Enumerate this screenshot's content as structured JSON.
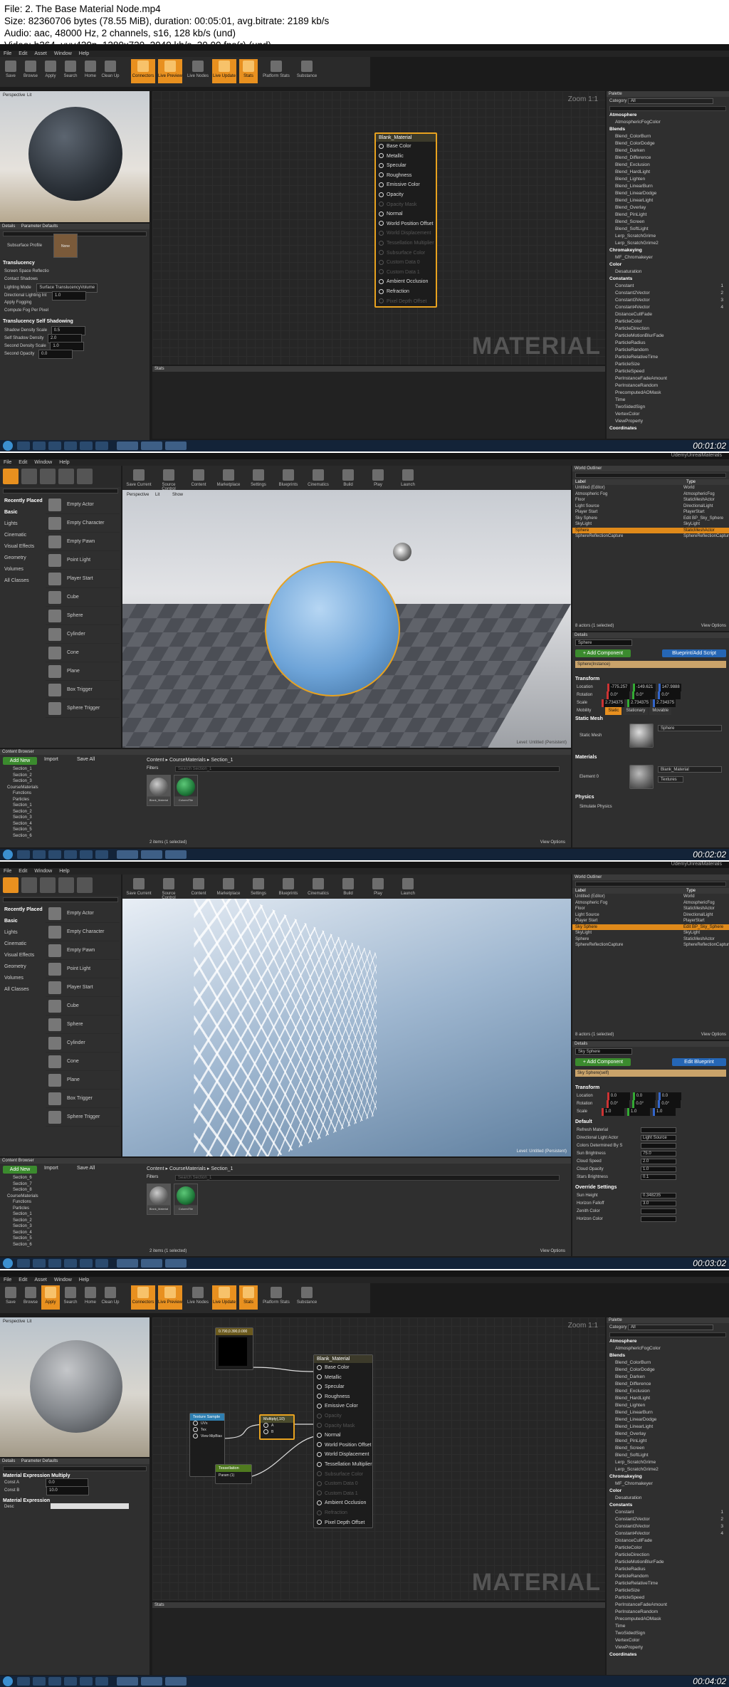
{
  "header": {
    "line1": "File: 2. The Base Material Node.mp4",
    "line2": "Size: 82360706 bytes (78.55 MiB), duration: 00:05:01, avg.bitrate: 2189 kb/s",
    "line3": "Audio: aac, 48000 Hz, 2 channels, s16, 128 kb/s (und)",
    "line4": "Video: h264, yuv420p, 1280x720, 2049 kb/s, 30.00 fps(r) (und)"
  },
  "menus": {
    "material_editor": [
      "File",
      "Edit",
      "Asset",
      "Window",
      "Help"
    ],
    "level_editor": [
      "File",
      "Edit",
      "Window",
      "Help"
    ]
  },
  "material_toolbar": [
    "Save",
    "Browse",
    "Apply",
    "Search",
    "Home",
    "Clean Up",
    "Connectors",
    "Live Preview",
    "Live Nodes",
    "Live Update",
    "Stats",
    "Platform Stats",
    "Substance"
  ],
  "level_toolbar": [
    "Save Current",
    "Source Control",
    "Content",
    "Marketplace",
    "Settings",
    "Blueprints",
    "Cinematics",
    "Build",
    "Play",
    "Launch"
  ],
  "project_name": "UdemyUnrealMaterials",
  "viewport": {
    "perspective": "Perspective",
    "lit": "Lit",
    "show": "Show",
    "level_label": "Level:  Untitled (Persistent)"
  },
  "graph": {
    "zoom": "Zoom 1:1",
    "watermark": "MATERIAL",
    "stats_tab": "Stats"
  },
  "base_node": {
    "title": "Blank_Material",
    "pins": [
      "Base Color",
      "Metallic",
      "Specular",
      "Roughness",
      "Emissive Color",
      "Opacity",
      "Opacity Mask",
      "Normal",
      "World Position Offset",
      "World Displacement",
      "Tessellation Multiplier",
      "Subsurface Color",
      "Custom Data 0",
      "Custom Data 1",
      "Ambient Occlusion",
      "Refraction",
      "Pixel Depth Offset"
    ],
    "dim_pins_frame1": [
      6,
      9,
      10,
      11,
      12,
      13,
      16
    ],
    "dim_pins_frame4": [
      5,
      6,
      11,
      12,
      13,
      15
    ]
  },
  "details_frame1": {
    "tabs": [
      "Details",
      "Parameter Defaults"
    ],
    "subsurface_label": "Subsurface Profile",
    "subsurface_value": "None",
    "section_translucency": "Translucency",
    "translucency_rows": [
      "Screen Space Reflectio",
      "Contact Shadows",
      "Lighting Mode",
      "Directional Lighting Int",
      "Apply Fogging",
      "Compute Fog Per Pixel"
    ],
    "lighting_mode_value": "Surface TranslucencyVolume",
    "directional_value": "1.0",
    "section_self_shadow": "Translucency Self Shadowing",
    "self_shadow_rows": [
      [
        "Shadow Density Scale",
        "0.5"
      ],
      [
        "Self Shadow Density",
        "2.0"
      ],
      [
        "Second Density Scale",
        "1.0"
      ],
      [
        "Second Opacity",
        "0.0"
      ]
    ]
  },
  "palette": {
    "title": "Palette",
    "category_label": "Category",
    "category_value": "All",
    "items": [
      {
        "t": "Atmosphere",
        "c": true
      },
      {
        "t": "AtmosphericFogColor"
      },
      {
        "t": "Blends",
        "c": true
      },
      {
        "t": "Blend_ColorBurn"
      },
      {
        "t": "Blend_ColorDodge"
      },
      {
        "t": "Blend_Darken"
      },
      {
        "t": "Blend_Difference"
      },
      {
        "t": "Blend_Exclusion"
      },
      {
        "t": "Blend_HardLight"
      },
      {
        "t": "Blend_Lighten"
      },
      {
        "t": "Blend_LinearBurn"
      },
      {
        "t": "Blend_LinearDodge"
      },
      {
        "t": "Blend_LinearLight"
      },
      {
        "t": "Blend_Overlay"
      },
      {
        "t": "Blend_PinLight"
      },
      {
        "t": "Blend_Screen"
      },
      {
        "t": "Blend_SoftLight"
      },
      {
        "t": "Lerp_ScratchGrime"
      },
      {
        "t": "Lerp_ScratchGrime2"
      },
      {
        "t": "Chromakeying",
        "c": true
      },
      {
        "t": "MF_Chromakeyer"
      },
      {
        "t": "Color",
        "c": true
      },
      {
        "t": "Desaturation"
      },
      {
        "t": "Constants",
        "c": true
      },
      {
        "t": "Constant",
        "n": "1"
      },
      {
        "t": "Constant2Vector",
        "n": "2"
      },
      {
        "t": "Constant3Vector",
        "n": "3"
      },
      {
        "t": "Constant4Vector",
        "n": "4"
      },
      {
        "t": "DistanceCullFade"
      },
      {
        "t": "ParticleColor"
      },
      {
        "t": "ParticleDirection"
      },
      {
        "t": "ParticleMotionBlurFade"
      },
      {
        "t": "ParticleRadius"
      },
      {
        "t": "ParticleRandom"
      },
      {
        "t": "ParticleRelativeTime"
      },
      {
        "t": "ParticleSize"
      },
      {
        "t": "ParticleSpeed"
      },
      {
        "t": "PerInstanceFadeAmount"
      },
      {
        "t": "PerInstanceRandom"
      },
      {
        "t": "PrecomputedAOMask"
      },
      {
        "t": "Time"
      },
      {
        "t": "TwoSidedSign"
      },
      {
        "t": "VertexColor"
      },
      {
        "t": "ViewProperty"
      },
      {
        "t": "Coordinates",
        "c": true
      }
    ]
  },
  "modes": {
    "title": "Modes",
    "search_placeholder": "Search Classes",
    "categories": [
      "Recently Placed",
      "Basic",
      "Lights",
      "Cinematic",
      "Visual Effects",
      "Geometry",
      "Volumes",
      "All Classes"
    ],
    "items": [
      "Empty Actor",
      "Empty Character",
      "Empty Pawn",
      "Point Light",
      "Player Start",
      "Cube",
      "Sphere",
      "Cylinder",
      "Cone",
      "Plane",
      "Box Trigger",
      "Sphere Trigger"
    ]
  },
  "world_outliner": {
    "title": "World Outliner",
    "col_label": "Label",
    "col_type": "Type",
    "rows": [
      [
        "Untitled (Editor)",
        "World"
      ],
      [
        "Atmospheric Fog",
        "AtmosphericFog"
      ],
      [
        "Floor",
        "StaticMeshActor"
      ],
      [
        "Light Source",
        "DirectionalLight"
      ],
      [
        "Player Start",
        "PlayerStart"
      ],
      [
        "Sky Sphere",
        "Edit BP_Sky_Sphere"
      ],
      [
        "SkyLight",
        "SkyLight"
      ],
      [
        "Sphere",
        "StaticMeshActor"
      ],
      [
        "SphereReflectionCapture",
        "SphereReflectionCapture"
      ]
    ],
    "selected_frame2": 7,
    "selected_frame3": 5,
    "count_frame2": "8 actors (1 selected)",
    "count_frame3": "8 actors (1 selected)",
    "view_options": "View Options"
  },
  "details_frame2": {
    "title": "Details",
    "name": "Sphere",
    "add_component": "+ Add Component",
    "blueprint": "Blueprint/Add Script",
    "instance": "Sphere(Instance)",
    "transform": "Transform",
    "location": [
      "-775.257",
      "-149.621",
      "147.9888"
    ],
    "rotation": [
      "0.0°",
      "0.0°",
      "0.0°"
    ],
    "scale": [
      "2.734375",
      "2.734375",
      "2.734375"
    ],
    "labels": [
      "Location",
      "Rotation",
      "Scale",
      "Mobility"
    ],
    "mobility": [
      "Static",
      "Stationary",
      "Movable"
    ],
    "static_mesh_section": "Static Mesh",
    "static_mesh_label": "Static Mesh",
    "static_mesh_value": "Sphere",
    "materials_section": "Materials",
    "element_label": "Element 0",
    "element_value": "Blank_Material",
    "element_tex": "Textures",
    "physics_section": "Physics",
    "simulate_physics": "Simulate Physics"
  },
  "details_frame3": {
    "name": "Sky Sphere",
    "add_component": "+ Add Component",
    "blueprint": "Edit Blueprint",
    "instance": "Sky Sphere(self)",
    "transform": "Transform",
    "location": [
      "0.0",
      "0.0",
      "0.0"
    ],
    "rotation": [
      "0.0°",
      "0.0°",
      "0.0°"
    ],
    "scale": [
      "1.0",
      "1.0",
      "1.0"
    ],
    "default_section": "Default",
    "rows": [
      [
        "Refresh Material",
        ""
      ],
      [
        "Directional Light Actor",
        "Light Source"
      ],
      [
        "Colors Determined By S",
        ""
      ],
      [
        "Sun Brightness",
        "75.0"
      ],
      [
        "Cloud Speed",
        "2.0"
      ],
      [
        "Cloud Opacity",
        "1.0"
      ],
      [
        "Stars Brightness",
        "0.1"
      ]
    ],
    "override_section": "Override Settings",
    "override_rows": [
      [
        "Sun Height",
        "0.348235"
      ],
      [
        "Horizon Falloff",
        "3.0"
      ],
      [
        "Zenith Color",
        ""
      ],
      [
        "Horizon Color",
        ""
      ]
    ]
  },
  "content_browser": {
    "title": "Content Browser",
    "add_new": "Add New",
    "import": "Import",
    "save_all": "Save All",
    "path": [
      "Content",
      "CourseMaterials",
      "Section_1"
    ],
    "filters": "Filters",
    "search_placeholder": "Search Section_1",
    "assets": [
      "Blank_Material",
      "ColoredTile"
    ],
    "count_frame2": "2 items (1 selected)",
    "count_frame3": "2 items (1 selected)",
    "view_options": "View Options",
    "folders_frame2": [
      "Section_1",
      "Section_2",
      "Section_3",
      "CourseMaterials",
      "Functions",
      "Particles",
      "Section_1",
      "Section_2",
      "Section_3",
      "Section_4",
      "Section_5",
      "Section_6"
    ],
    "folders_frame3": [
      "Section_6",
      "Section_7",
      "Section_8",
      "CourseMaterials",
      "Functions",
      "Particles",
      "Section_1",
      "Section_2",
      "Section_3",
      "Section_4",
      "Section_5",
      "Section_6"
    ]
  },
  "frame4_nodes": {
    "constant3": "0.790,0.390,0.000",
    "texture_sample": "Texture Sample",
    "texture_pins": [
      "UVs",
      "Tex",
      "View MipBias"
    ],
    "multiply": "Multiply(,10)",
    "multiply_pins": [
      "A",
      "B"
    ],
    "tessellation": "Tessellation",
    "tessellation_sub": "Param (1)"
  },
  "details_frame4": {
    "section1": "Material Expression Multiply",
    "rows": [
      [
        "Const A",
        "0.0"
      ],
      [
        "Const B",
        "10.0"
      ]
    ],
    "section2": "Material Expression",
    "desc_label": "Desc"
  },
  "timestamps": [
    "00:01:02",
    "00:02:02",
    "00:03:02",
    "00:04:02"
  ]
}
